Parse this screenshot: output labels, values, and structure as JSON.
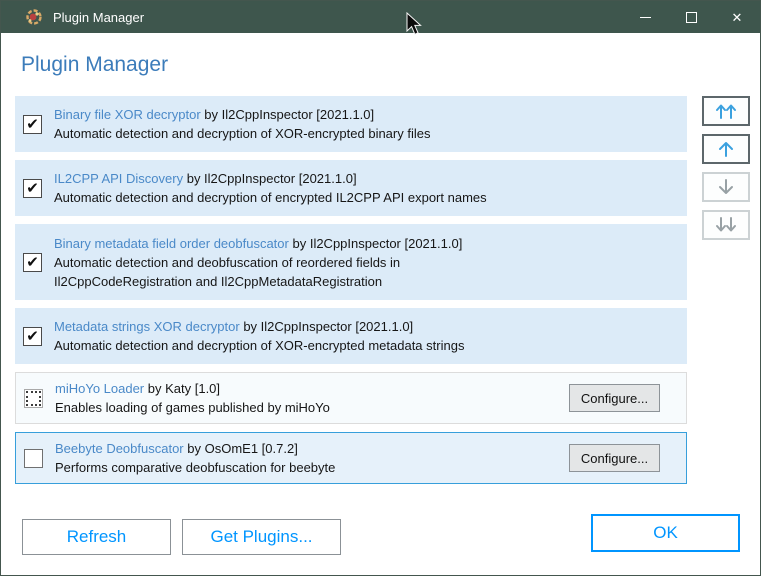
{
  "window": {
    "title": "Plugin Manager"
  },
  "header": {
    "title": "Plugin Manager"
  },
  "icons": {
    "check": "✔",
    "close": "✕"
  },
  "plugins": [
    {
      "name": "Binary file XOR decryptor",
      "byline": "by Il2CppInspector [2021.1.0]",
      "description": "Automatic detection and decryption of XOR-encrypted binary files",
      "state": "checked"
    },
    {
      "name": "IL2CPP API Discovery",
      "byline": "by Il2CppInspector [2021.1.0]",
      "description": "Automatic detection and decryption of encrypted IL2CPP API export names",
      "state": "checked"
    },
    {
      "name": "Binary metadata field order deobfuscator",
      "byline": "by Il2CppInspector [2021.1.0]",
      "description": "Automatic detection and deobfuscation of reordered fields in\nIl2CppCodeRegistration and Il2CppMetadataRegistration",
      "state": "checked"
    },
    {
      "name": "Metadata strings XOR decryptor",
      "byline": "by Il2CppInspector [2021.1.0]",
      "description": "Automatic detection and decryption of XOR-encrypted metadata strings",
      "state": "checked"
    },
    {
      "name": "miHoYo Loader",
      "byline": "by Katy [1.0]",
      "description": "Enables loading of games published by miHoYo",
      "state": "indeterminate",
      "configure_label": "Configure..."
    },
    {
      "name": "Beebyte Deobfuscator",
      "byline": "by OsOmE1 [0.7.2]",
      "description": "Performs comparative deobfuscation for beebyte",
      "state": "unchecked",
      "selected": true,
      "configure_label": "Configure..."
    }
  ],
  "reorder_buttons": [
    {
      "action": "move-to-top",
      "enabled": true
    },
    {
      "action": "move-up",
      "enabled": true
    },
    {
      "action": "move-down",
      "enabled": false
    },
    {
      "action": "move-to-bottom",
      "enabled": false
    }
  ],
  "footer": {
    "refresh_label": "Refresh",
    "get_plugins_label": "Get Plugins...",
    "ok_label": "OK"
  },
  "colors": {
    "titlebar": "#3e564d",
    "heading_blue": "#3c7cba",
    "link_blue": "#4a89c8",
    "row_background": "#dcebf8",
    "selected_row_border": "#379fdb",
    "accent_blue": "#0095ff"
  }
}
